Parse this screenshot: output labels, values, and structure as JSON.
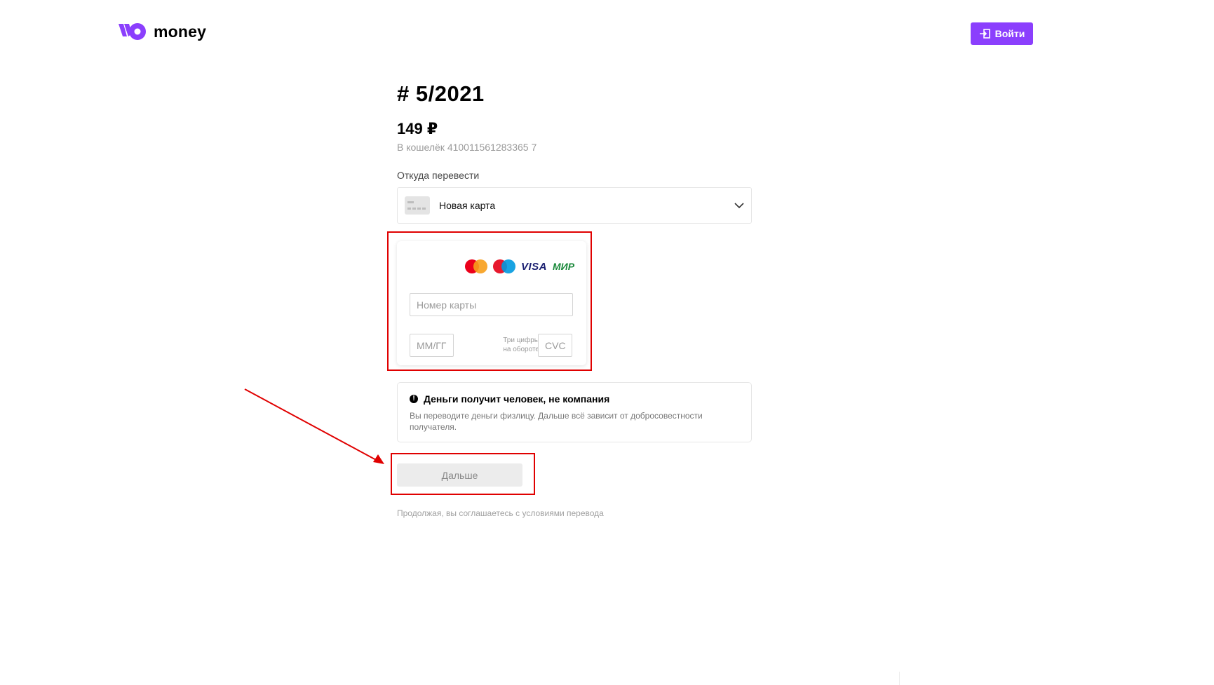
{
  "header": {
    "logo_text": "money",
    "login_label": "Войти"
  },
  "invoice": {
    "title": "# 5/2021",
    "amount": "149 ₽",
    "wallet": "В кошелёк 410011561283365 7"
  },
  "source": {
    "label": "Откуда перевести",
    "selected": "Новая карта"
  },
  "card_form": {
    "payment_systems": [
      "Mastercard",
      "Maestro",
      "VISA",
      "МИР"
    ],
    "visa_text": "VISA",
    "mir_text": "МИР",
    "card_number_placeholder": "Номер карты",
    "expiry_placeholder": "ММ/ГГ",
    "cvc_hint_line1": "Три цифры",
    "cvc_hint_line2": "на обороте",
    "cvc_placeholder": "CVC"
  },
  "notice": {
    "title": "Деньги получит человек, не компания",
    "text": "Вы переводите деньги физлицу. Дальше всё зависит от добросовестности получателя."
  },
  "next_label": "Дальше",
  "terms": "Продолжая, вы соглашаетесь с условиями перевода",
  "colors": {
    "accent": "#8b3ffd",
    "annotation": "#e00000"
  }
}
